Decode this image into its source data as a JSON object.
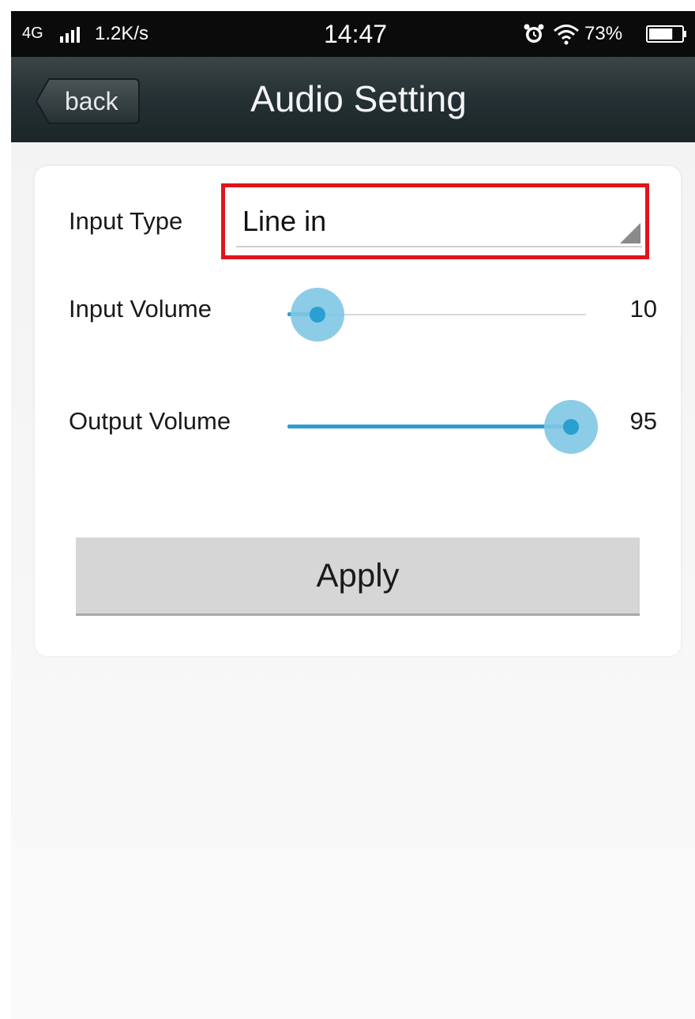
{
  "status_bar": {
    "network": "4G",
    "signal_icon": "signal-bars-icon",
    "speed": "1.2K/s",
    "time": "14:47",
    "alarm_icon": "alarm-clock-icon",
    "wifi_icon": "wifi-icon",
    "battery_percent_text": "73%",
    "battery_level": 0.73,
    "battery_icon": "battery-icon"
  },
  "nav": {
    "back_label": "back",
    "title": "Audio Setting"
  },
  "form": {
    "input_type": {
      "label": "Input Type",
      "selected": "Line in",
      "arrow_icon": "dropdown-triangle-icon"
    },
    "input_volume": {
      "label": "Input Volume",
      "value": 10,
      "value_text": "10",
      "max": 100
    },
    "output_volume": {
      "label": "Output Volume",
      "value": 95,
      "value_text": "95",
      "max": 100
    },
    "apply_label": "Apply"
  },
  "colors": {
    "accent": "#2a9fd1",
    "highlight_border": "#e0141b",
    "nav_background": "#243033",
    "button_background": "#d6d6d6"
  }
}
